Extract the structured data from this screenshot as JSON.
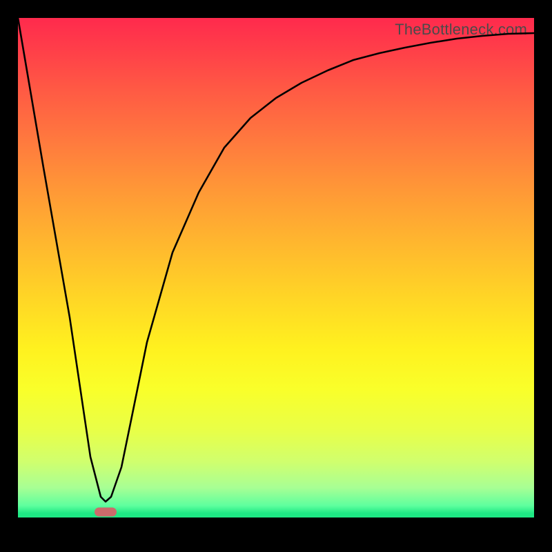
{
  "watermark": "TheBottleneck.com",
  "colors": {
    "frame": "#000000",
    "gradient_top": "#ff2a4d",
    "gradient_mid": "#fff11f",
    "gradient_green": "#1ee884",
    "curve": "#000000",
    "marker": "#cc6b6b"
  },
  "chart_data": {
    "type": "line",
    "title": "",
    "xlabel": "",
    "ylabel": "",
    "xlim": [
      0,
      100
    ],
    "ylim": [
      0,
      100
    ],
    "series": [
      {
        "name": "bottleneck-curve",
        "x": [
          0,
          5,
          10,
          14,
          16,
          17,
          18,
          20,
          22,
          25,
          30,
          35,
          40,
          45,
          50,
          55,
          60,
          65,
          70,
          75,
          80,
          85,
          90,
          95,
          100
        ],
        "y": [
          100,
          70,
          40,
          12,
          4,
          3,
          4,
          10,
          20,
          35,
          53,
          65,
          74,
          80,
          84,
          87,
          89.5,
          91.5,
          93,
          94,
          95,
          95.8,
          96.4,
          96.8,
          97
        ]
      }
    ],
    "annotations": [
      {
        "name": "optimum-marker",
        "x": 17,
        "y": 3
      }
    ],
    "background": "vertical-gradient red→yellow→green with black baseline band"
  }
}
